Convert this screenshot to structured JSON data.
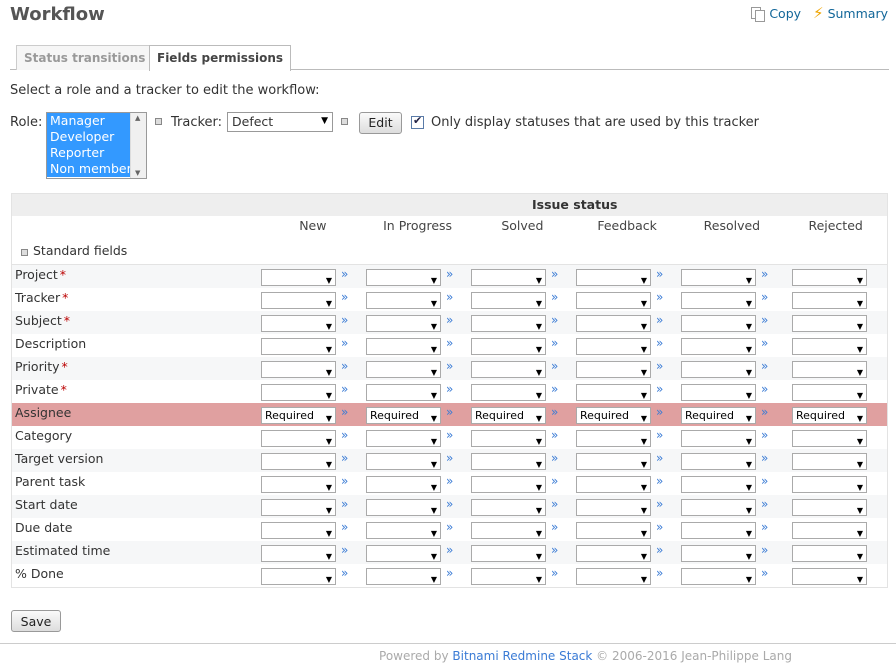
{
  "page": {
    "title": "Workflow"
  },
  "contextual": {
    "copy": "Copy",
    "summary": "Summary"
  },
  "tabs": [
    {
      "label": "Status transitions",
      "selected": false
    },
    {
      "label": "Fields permissions",
      "selected": true
    }
  ],
  "instruction": "Select a role and a tracker to edit the workflow:",
  "filters": {
    "role_label": "Role:",
    "roles": [
      "Manager",
      "Developer",
      "Reporter",
      "Non member"
    ],
    "tracker_label": "Tracker:",
    "tracker_value": "Defect",
    "edit_label": "Edit",
    "only_used_label": "Only display statuses that are used by this tracker",
    "only_used_checked": true
  },
  "table": {
    "issue_status_label": "Issue status",
    "statuses": [
      "New",
      "In Progress",
      "Solved",
      "Feedback",
      "Resolved",
      "Rejected"
    ],
    "section_label": "Standard fields",
    "fields": [
      {
        "name": "Project",
        "required": true,
        "value": ""
      },
      {
        "name": "Tracker",
        "required": true,
        "value": ""
      },
      {
        "name": "Subject",
        "required": true,
        "value": ""
      },
      {
        "name": "Description",
        "required": false,
        "value": ""
      },
      {
        "name": "Priority",
        "required": true,
        "value": ""
      },
      {
        "name": "Private",
        "required": true,
        "value": ""
      },
      {
        "name": "Assignee",
        "required": false,
        "value": "Required"
      },
      {
        "name": "Category",
        "required": false,
        "value": ""
      },
      {
        "name": "Target version",
        "required": false,
        "value": ""
      },
      {
        "name": "Parent task",
        "required": false,
        "value": ""
      },
      {
        "name": "Start date",
        "required": false,
        "value": ""
      },
      {
        "name": "Due date",
        "required": false,
        "value": ""
      },
      {
        "name": "Estimated time",
        "required": false,
        "value": ""
      },
      {
        "name": "% Done",
        "required": false,
        "value": ""
      }
    ],
    "required_star": "*",
    "raquo": "»"
  },
  "save_label": "Save",
  "footer": {
    "powered_by": "Powered by",
    "link_text": "Bitnami Redmine Stack",
    "copyright": "© 2006-2016 Jean-Philippe Lang"
  },
  "colors": {
    "link": "#3a7bd5",
    "required_row": "#e0a0a0",
    "role_selected": "#3399ff"
  }
}
